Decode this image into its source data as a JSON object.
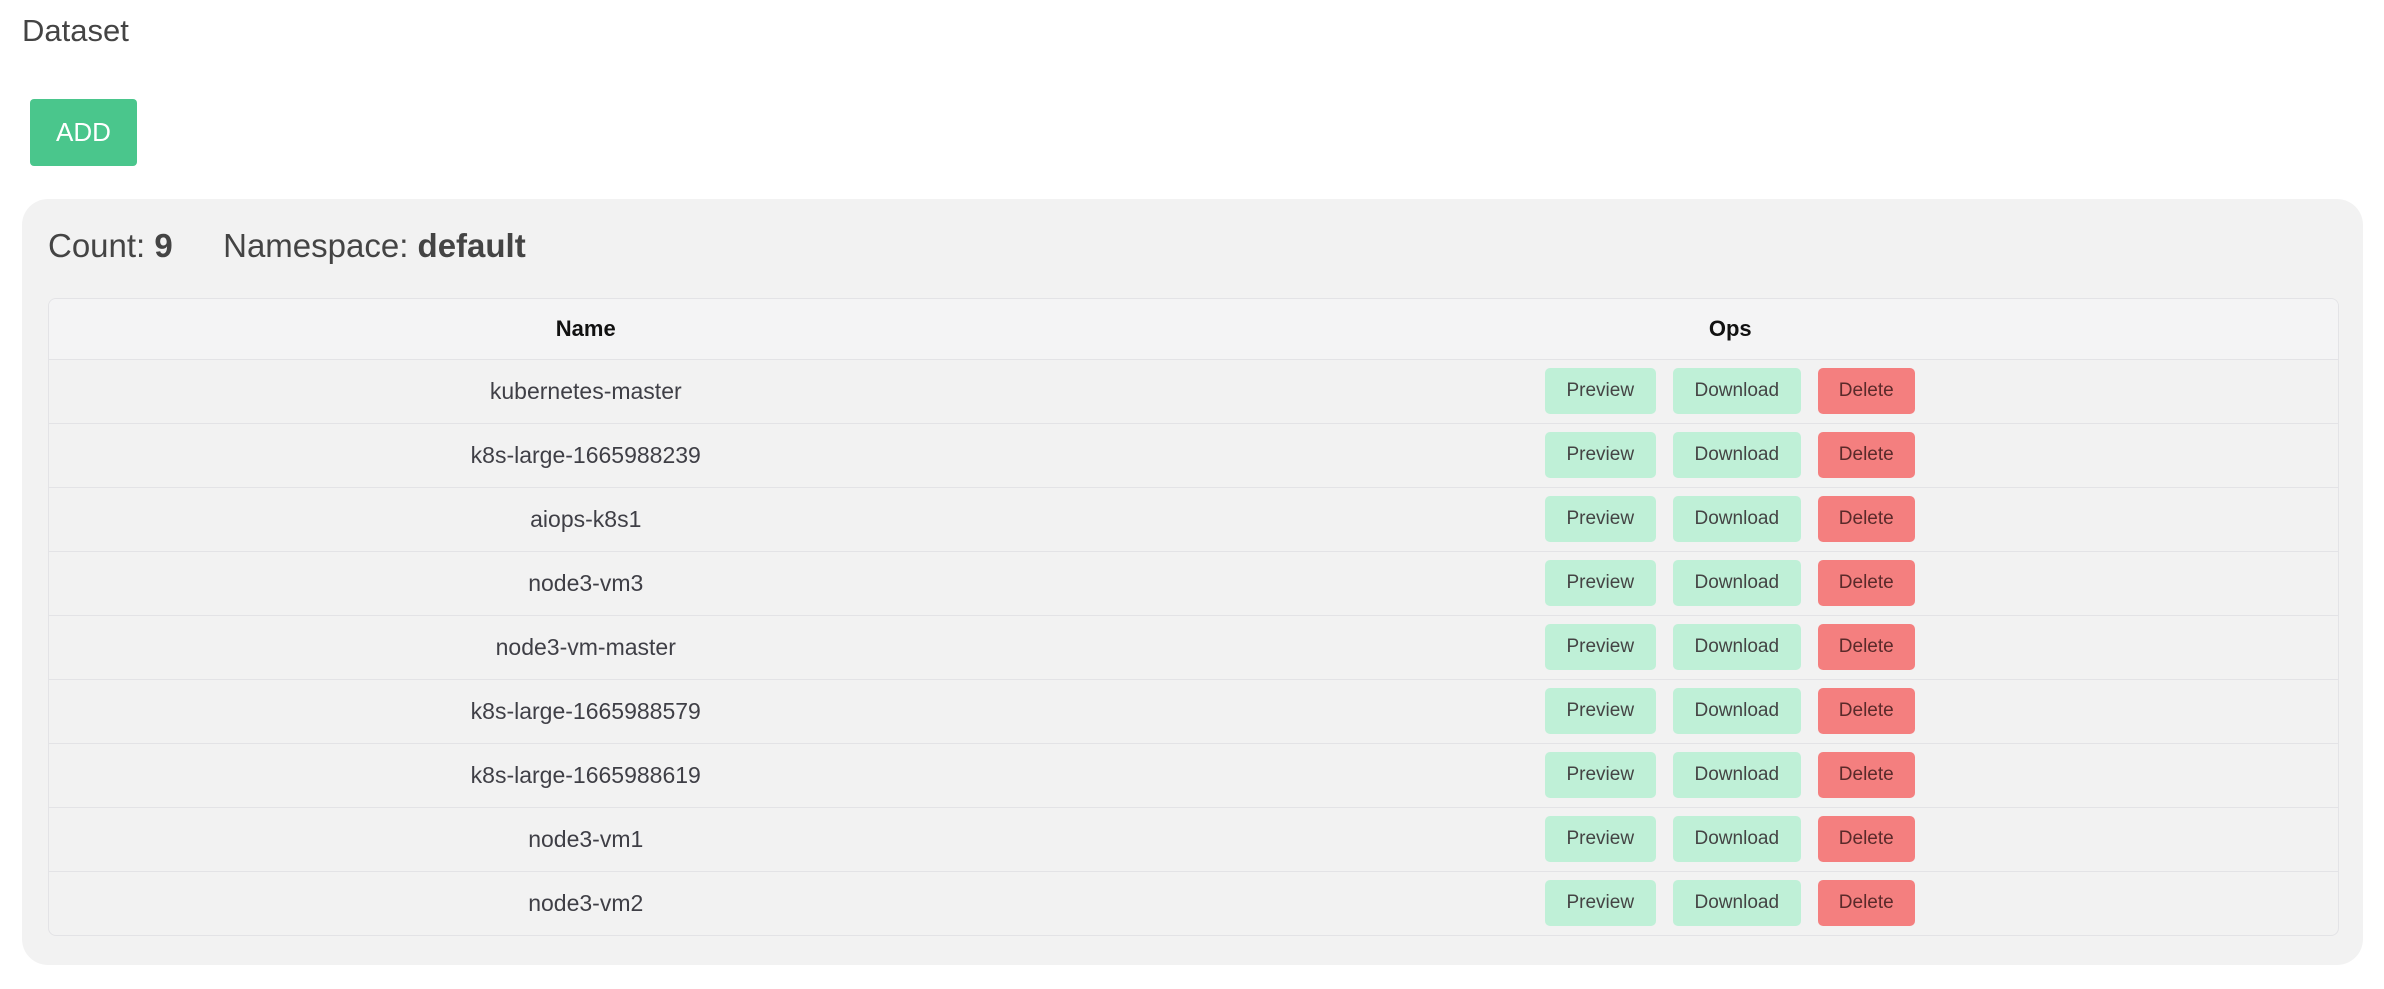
{
  "page": {
    "title": "Dataset"
  },
  "toolbar": {
    "add_label": "ADD"
  },
  "summary": {
    "count_label": "Count:",
    "count_value": "9",
    "namespace_label": "Namespace:",
    "namespace_value": "default"
  },
  "table": {
    "headers": {
      "name": "Name",
      "ops": "Ops"
    },
    "actions": {
      "preview": "Preview",
      "download": "Download",
      "delete": "Delete"
    },
    "rows": [
      {
        "name": "kubernetes-master"
      },
      {
        "name": "k8s-large-1665988239"
      },
      {
        "name": "aiops-k8s1"
      },
      {
        "name": "node3-vm3"
      },
      {
        "name": "node3-vm-master"
      },
      {
        "name": "k8s-large-1665988579"
      },
      {
        "name": "k8s-large-1665988619"
      },
      {
        "name": "node3-vm1"
      },
      {
        "name": "node3-vm2"
      }
    ]
  },
  "colors": {
    "add": "#4ac68c",
    "preview": "#bff0d7",
    "download": "#bff0d7",
    "delete": "#f47f7f",
    "panel": "#f2f2f2"
  }
}
